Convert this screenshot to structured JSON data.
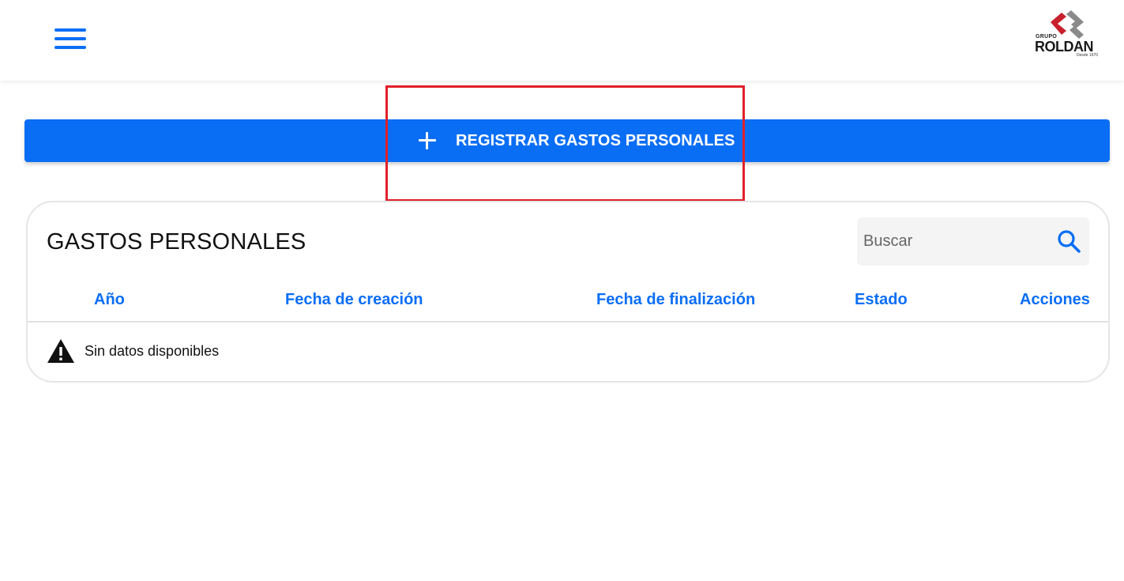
{
  "header": {
    "menu_icon": "hamburger-menu-icon",
    "logo": {
      "group": "GRUPO",
      "name": "ROLDAN",
      "since": "Desde 1970"
    }
  },
  "actions": {
    "register_label": "REGISTRAR GASTOS PERSONALES",
    "register_icon": "plus-icon"
  },
  "table": {
    "title": "GASTOS PERSONALES",
    "search": {
      "placeholder": "Buscar",
      "value": "",
      "icon": "search-icon"
    },
    "columns": [
      "Año",
      "Fecha de creación",
      "Fecha de finalización",
      "Estado",
      "Acciones"
    ],
    "empty_message": "Sin datos disponibles",
    "empty_icon": "warning-icon"
  },
  "colors": {
    "accent": "#0a6ef5",
    "annotation": "#e0202a",
    "logo_red": "#c8202c",
    "logo_gray": "#8a8a8a"
  }
}
